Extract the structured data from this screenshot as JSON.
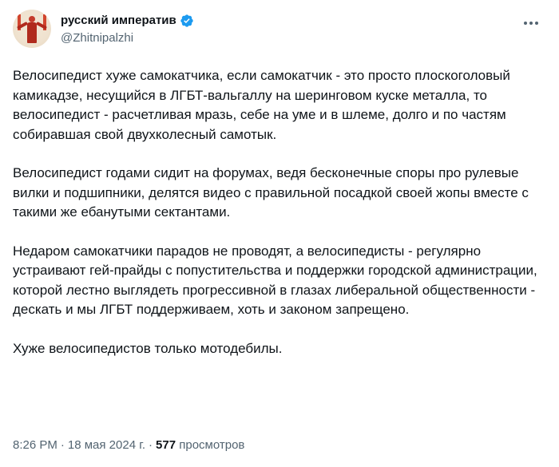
{
  "user": {
    "display_name": "русский императив",
    "handle": "@Zhitnipalzhi",
    "verified": true,
    "verified_color": "#1d9bf0"
  },
  "tweet": {
    "paragraphs": [
      "Велосипедист хуже самокатчика, если самокатчик - это просто плоскоголовый камикадзе, несущийся в ЛГБТ-вальгаллу на шеринговом куске металла, то велосипедист - расчетливая мразь, себе на уме и в шлеме, долго и по частям собиравшая свой двухколесный самотык.",
      "Велосипедист годами сидит на форумах, ведя бесконечные споры про рулевые вилки и подшипники, делятся видео с правильной посадкой своей жопы вместе с такими же ебанутыми сектантами.",
      "Недаром самокатчики парадов не проводят, а велосипедисты - регулярно устраивают гей-прайды с попустительства и поддержки городской администрации, которой лестно выглядеть прогрессивной в глазах либеральной общественности - дескать и мы ЛГБТ поддерживаем, хоть и законом запрещено.",
      "Хуже велосипедистов только мотодебилы."
    ]
  },
  "meta": {
    "time": "8:26 PM",
    "date": "18 мая 2024 г.",
    "views_count": "577",
    "views_label": "просмотров",
    "separator": "·"
  },
  "icons": {
    "more": "more-dots-icon",
    "verified": "verified-badge-icon"
  }
}
